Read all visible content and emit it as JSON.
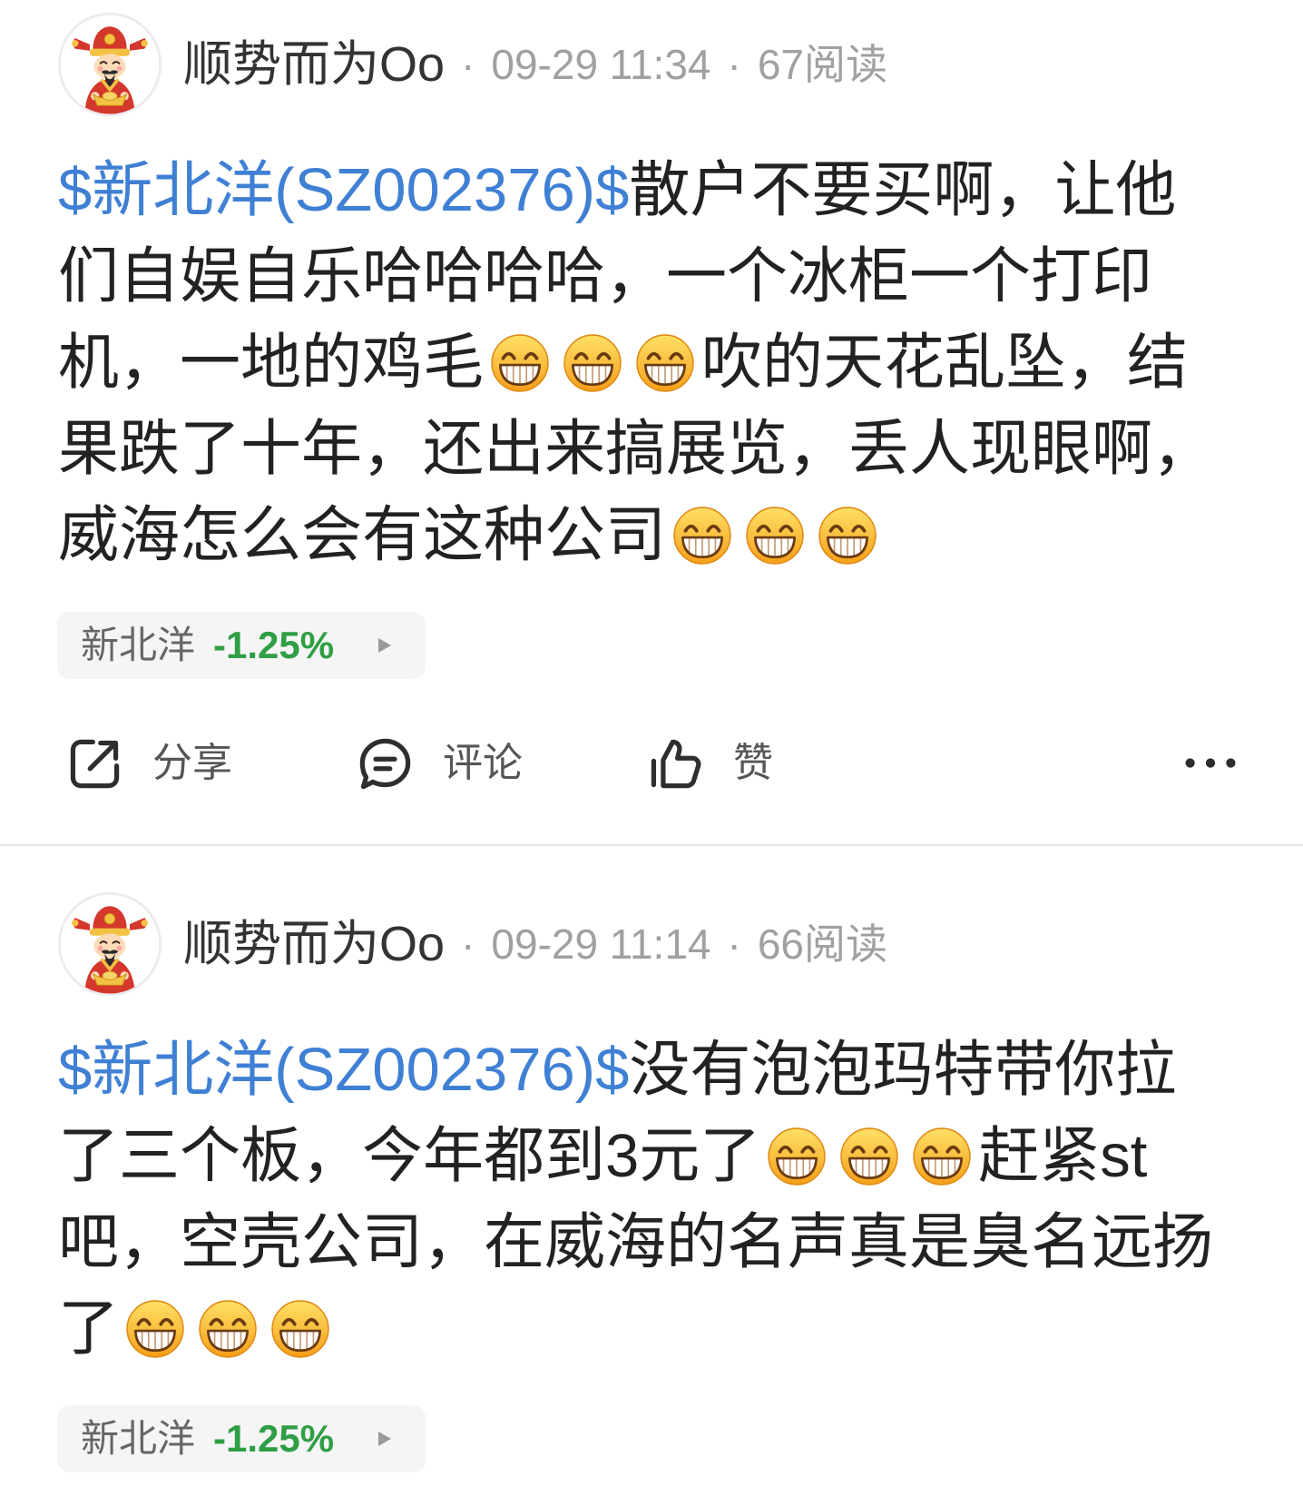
{
  "colors": {
    "stock_link": "#3f80d4",
    "price_down": "#2f9e44",
    "body_text": "#222222",
    "meta_text": "#a0a0a0",
    "action_text": "#555555"
  },
  "posts": [
    {
      "author": {
        "name": "顺势而为Oo",
        "avatar_icon": "god-of-wealth-avatar"
      },
      "separator": "·",
      "time": "09-29 11:34",
      "reads": "67阅读",
      "lines": [
        [
          {
            "type": "stock",
            "text": "$新北洋(SZ002376)$"
          },
          {
            "type": "text",
            "text": "散户不要买啊，让他"
          }
        ],
        [
          {
            "type": "text",
            "text": "们自娱自乐哈哈哈哈，一个冰柜一个打印"
          }
        ],
        [
          {
            "type": "text",
            "text": "机，一地的鸡毛"
          },
          {
            "type": "emoji",
            "icon": "beaming-face-icon"
          },
          {
            "type": "emoji",
            "icon": "beaming-face-icon"
          },
          {
            "type": "emoji",
            "icon": "beaming-face-icon"
          },
          {
            "type": "text",
            "text": "吹的天花乱坠，结"
          }
        ],
        [
          {
            "type": "text",
            "text": "果跌了十年，还出来搞展览，丢人现眼啊，"
          }
        ],
        [
          {
            "type": "text",
            "text": "威海怎么会有这种公司"
          },
          {
            "type": "emoji",
            "icon": "beaming-face-icon"
          },
          {
            "type": "emoji",
            "icon": "beaming-face-icon"
          },
          {
            "type": "emoji",
            "icon": "beaming-face-icon"
          }
        ]
      ],
      "stock_chip": {
        "name": "新北洋",
        "change": "-1.25%",
        "arrow_icon": "play-triangle-icon"
      },
      "actions": {
        "share": {
          "label": "分享",
          "icon": "share-icon"
        },
        "comment": {
          "label": "评论",
          "icon": "comment-icon"
        },
        "like": {
          "label": "赞",
          "icon": "thumbs-up-icon"
        },
        "more_icon": "more-dots-icon"
      }
    },
    {
      "author": {
        "name": "顺势而为Oo",
        "avatar_icon": "god-of-wealth-avatar"
      },
      "separator": "·",
      "time": "09-29 11:14",
      "reads": "66阅读",
      "lines": [
        [
          {
            "type": "stock",
            "text": "$新北洋(SZ002376)$"
          },
          {
            "type": "text",
            "text": "没有泡泡玛特带你拉"
          }
        ],
        [
          {
            "type": "text",
            "text": "了三个板，今年都到3元了"
          },
          {
            "type": "emoji",
            "icon": "beaming-face-icon"
          },
          {
            "type": "emoji",
            "icon": "beaming-face-icon"
          },
          {
            "type": "emoji",
            "icon": "beaming-face-icon"
          },
          {
            "type": "text",
            "text": "赶紧st"
          }
        ],
        [
          {
            "type": "text",
            "text": "吧，空壳公司，在威海的名声真是臭名远扬"
          }
        ],
        [
          {
            "type": "text",
            "text": "了"
          },
          {
            "type": "emoji",
            "icon": "beaming-face-icon"
          },
          {
            "type": "emoji",
            "icon": "beaming-face-icon"
          },
          {
            "type": "emoji",
            "icon": "beaming-face-icon"
          }
        ]
      ],
      "stock_chip": {
        "name": "新北洋",
        "change": "-1.25%",
        "arrow_icon": "play-triangle-icon"
      }
    }
  ]
}
